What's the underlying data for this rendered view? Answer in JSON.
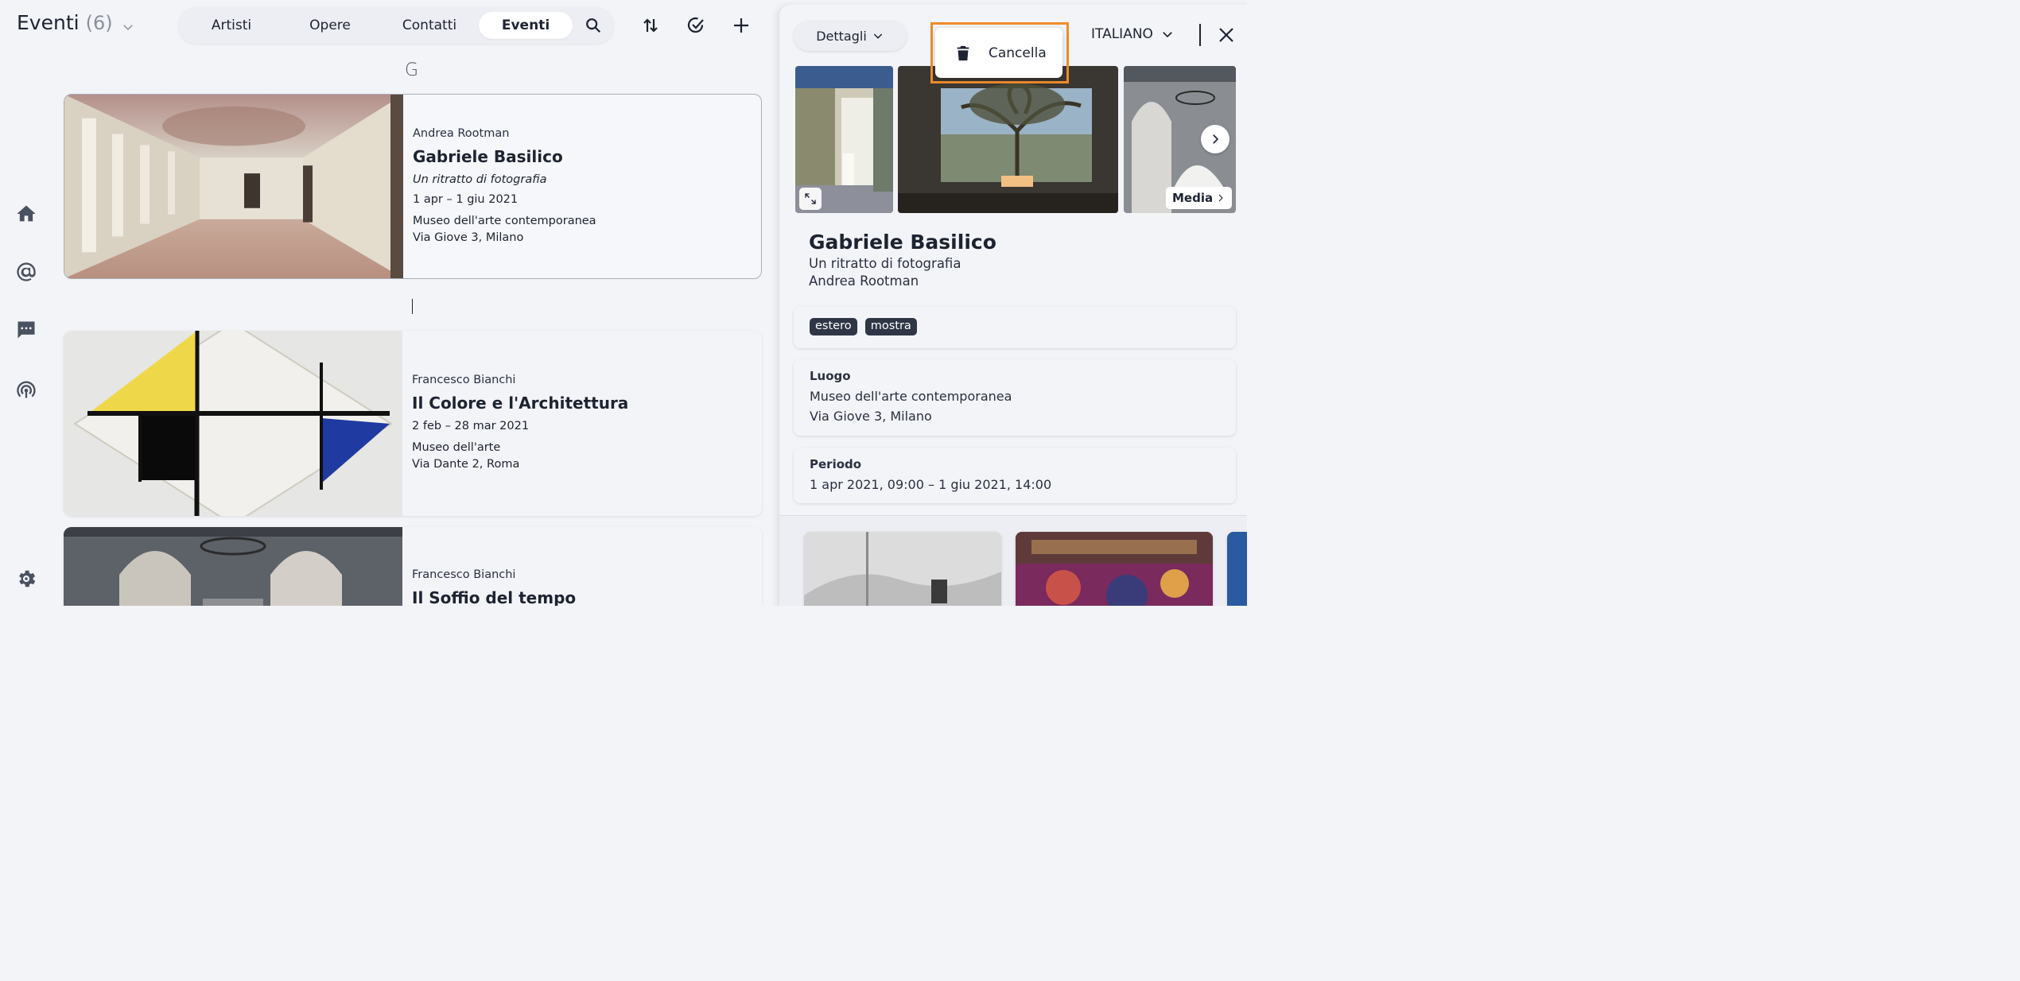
{
  "header": {
    "title": "Eventi",
    "count": "(6)",
    "tabs": [
      {
        "label": "Artisti"
      },
      {
        "label": "Opere"
      },
      {
        "label": "Contatti"
      },
      {
        "label": "Eventi"
      }
    ],
    "active_tab": "Eventi"
  },
  "list": {
    "sections": [
      {
        "letter": "G"
      },
      {
        "letter": "I"
      }
    ],
    "cards": [
      {
        "artist": "Andrea Rootman",
        "title": "Gabriele Basilico",
        "subtitle": "Un ritratto di fotografia",
        "dates": "1 apr – 1 giu 2021",
        "venue": "Museo dell'arte contemporanea",
        "address": "Via Giove 3, Milano"
      },
      {
        "artist": "Francesco Bianchi",
        "title": "Il Colore e l'Architettura",
        "dates": "2 feb – 28 mar 2021",
        "venue": "Museo dell'arte",
        "address": "Via Dante 2, Roma"
      },
      {
        "artist": "Francesco Bianchi",
        "title": "Il Soffio del tempo"
      }
    ]
  },
  "panel": {
    "view_label": "Dettagli",
    "language": "ITALIANO",
    "media_label": "Media",
    "title": "Gabriele Basilico",
    "subtitle": "Un ritratto di fotografia",
    "author": "Andrea Rootman",
    "tags": [
      "estero",
      "mostra"
    ],
    "location": {
      "label": "Luogo",
      "venue": "Museo dell'arte contemporanea",
      "address": "Via Giove 3, Milano"
    },
    "period": {
      "label": "Periodo",
      "value": "1 apr 2021, 09:00 – 1 giu 2021, 14:00"
    }
  },
  "popup": {
    "delete_label": "Cancella"
  },
  "colors": {
    "highlight": "#f08c2a",
    "tag_bg": "#2f3645",
    "background": "#f3f4f8"
  },
  "icons": {
    "rail": [
      "home-icon",
      "at-icon",
      "chat-icon",
      "broadcast-icon",
      "settings-icon"
    ],
    "header": [
      "search-icon",
      "sort-icon",
      "check-circle-icon",
      "plus-icon"
    ],
    "panel": [
      "chevron-down-icon",
      "close-icon",
      "expand-icon",
      "chevron-right-icon",
      "trash-icon"
    ]
  }
}
